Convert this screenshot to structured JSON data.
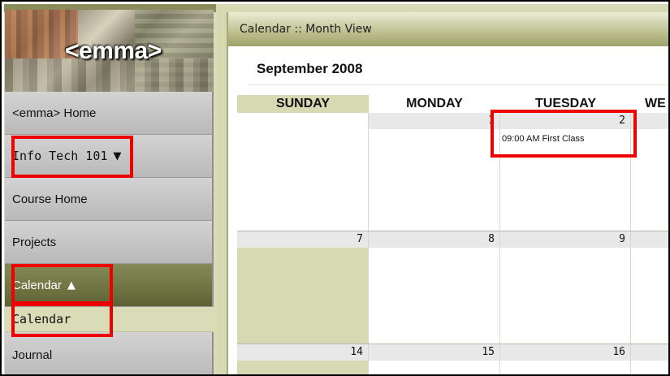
{
  "app": {
    "logo_text": "<emma>",
    "title": "Calendar :: Month View",
    "month_label": "September 2008"
  },
  "sidebar": {
    "items": [
      {
        "label": "<emma> Home"
      },
      {
        "label": "Info Tech 101",
        "caret": "▼"
      },
      {
        "label": "Course Home"
      },
      {
        "label": "Projects"
      },
      {
        "label": "Calendar",
        "caret": "▲"
      },
      {
        "label": "Calendar"
      },
      {
        "label": "Journal"
      }
    ]
  },
  "calendar": {
    "weekdays": [
      "SUNDAY",
      "MONDAY",
      "TUESDAY",
      "WE"
    ],
    "weeks": [
      {
        "days": [
          "",
          "1",
          "2",
          ""
        ]
      },
      {
        "days": [
          "7",
          "8",
          "9",
          ""
        ]
      },
      {
        "days": [
          "14",
          "15",
          "16",
          ""
        ]
      }
    ],
    "events": [
      {
        "time": "09:00 AM",
        "title": "First Class",
        "text": "09:00 AM First Class"
      }
    ]
  },
  "colors": {
    "olive_nav": "#6e7341",
    "highlight": "#ee0000",
    "sunday_col": "#d6d9b1"
  },
  "icons": {
    "caret_down": "caret-down-icon",
    "caret_up": "caret-up-icon"
  }
}
